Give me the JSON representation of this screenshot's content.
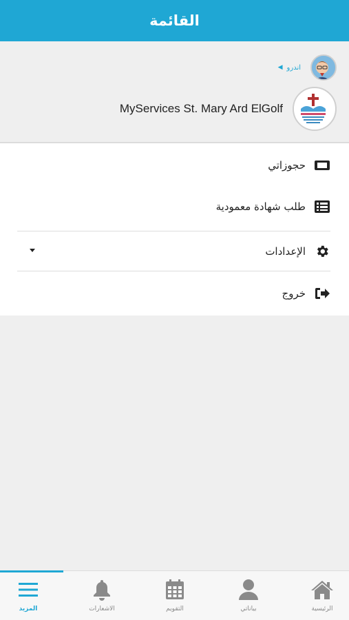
{
  "header": {
    "title": "القائمة"
  },
  "profile": {
    "user_name": "اندرو",
    "avatar_icon": "user-avatar",
    "service_name": "MyServices St. Mary Ard ElGolf",
    "logo_icon": "church-logo"
  },
  "menu": {
    "items": [
      {
        "label": "حجوزاتي",
        "icon": "ticket-icon"
      },
      {
        "label": "طلب شهادة معمودية",
        "icon": "list-icon"
      },
      {
        "label": "الإعدادات",
        "icon": "gear-icon"
      },
      {
        "label": "خروج",
        "icon": "sign-out-icon"
      }
    ]
  },
  "tabbar": {
    "tabs": [
      {
        "label": "المزيد",
        "icon": "menu-icon",
        "active": true
      },
      {
        "label": "الاشعارات",
        "icon": "bell-icon",
        "active": false
      },
      {
        "label": "التقويم",
        "icon": "calendar-icon",
        "active": false
      },
      {
        "label": "بياناتي",
        "icon": "user-icon",
        "active": false
      },
      {
        "label": "الرئيسية",
        "icon": "home-icon",
        "active": false
      }
    ]
  },
  "colors": {
    "accent": "#1fa7d4",
    "inactive": "#888888"
  }
}
